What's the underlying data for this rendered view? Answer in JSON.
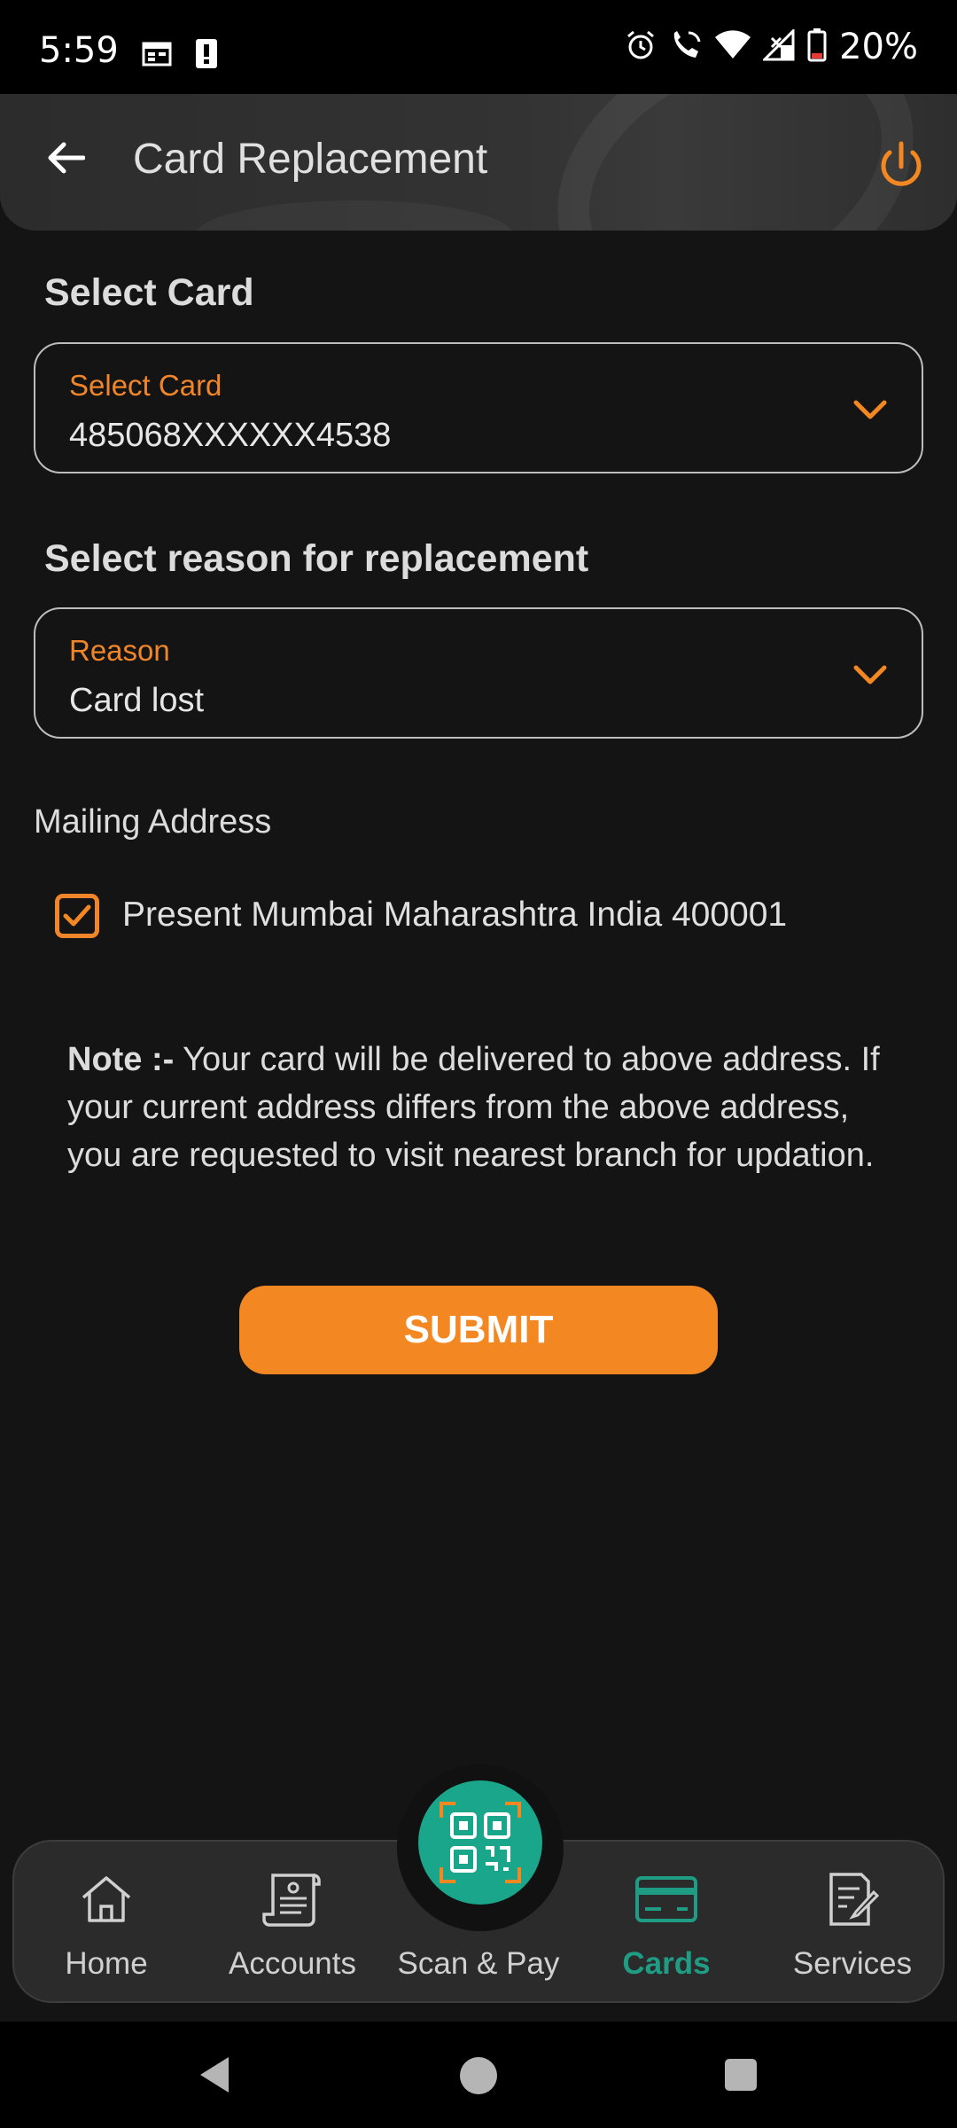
{
  "status_bar": {
    "time": "5:59",
    "battery": "20%",
    "icons": [
      "calendar-icon",
      "alert-icon",
      "alarm-icon",
      "wifi-call-icon",
      "wifi-icon",
      "signal-icon",
      "battery-icon"
    ]
  },
  "header": {
    "title": "Card Replacement"
  },
  "card_section": {
    "heading": "Select Card",
    "field_label": "Select Card",
    "field_value": "485068XXXXXX4538"
  },
  "reason_section": {
    "heading": "Select reason for replacement",
    "field_label": "Reason",
    "field_value": "Card lost"
  },
  "mailing": {
    "label": "Mailing Address",
    "address": "Present Mumbai Maharashtra India 400001",
    "checked": true
  },
  "note": {
    "prefix": "Note :-",
    "text": " Your card will be delivered to above address. If your current address differs from the above address, you are requested to visit nearest branch for updation."
  },
  "submit_label": "SUBMIT",
  "bottom_nav": {
    "items": [
      {
        "label": "Home",
        "icon": "home-icon"
      },
      {
        "label": "Accounts",
        "icon": "accounts-icon"
      },
      {
        "label": "Scan & Pay",
        "icon": "qr-code-icon"
      },
      {
        "label": "Cards",
        "icon": "card-icon",
        "active": true
      },
      {
        "label": "Services",
        "icon": "services-icon"
      }
    ]
  },
  "colors": {
    "accent": "#f38722",
    "active_nav": "#1f9d84",
    "background": "#141414"
  }
}
